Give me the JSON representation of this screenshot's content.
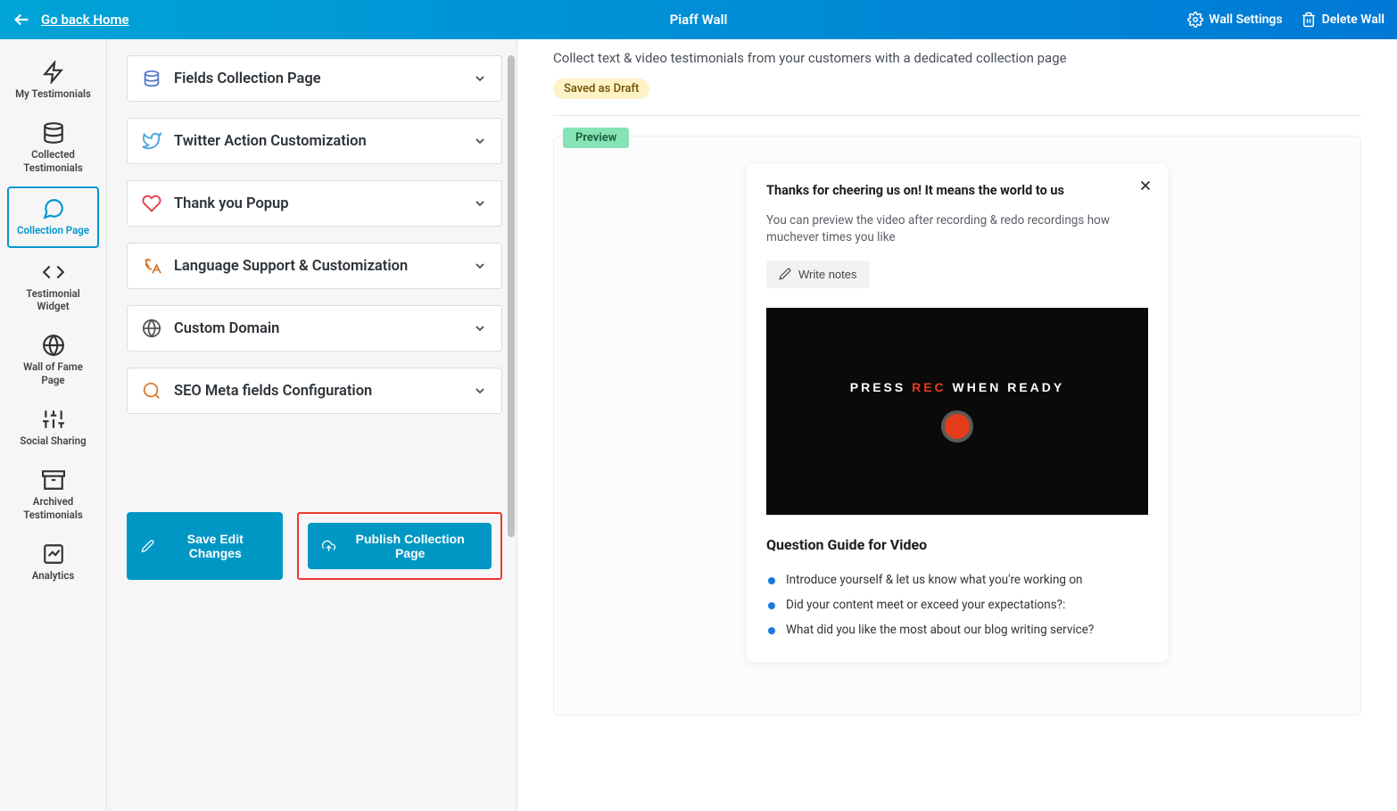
{
  "topbar": {
    "back_label": "Go back Home",
    "title": "Piaff Wall",
    "settings_label": "Wall Settings",
    "delete_label": "Delete Wall"
  },
  "sidebar": {
    "items": [
      {
        "label": "My Testimonials"
      },
      {
        "label": "Collected Testimonials"
      },
      {
        "label": "Collection Page"
      },
      {
        "label": "Testimonial Widget"
      },
      {
        "label": "Wall of Fame Page"
      },
      {
        "label": "Social Sharing"
      },
      {
        "label": "Archived Testimonials"
      },
      {
        "label": "Analytics"
      }
    ]
  },
  "panel": {
    "accordions": [
      {
        "label": "Fields Collection Page"
      },
      {
        "label": "Twitter Action Customization"
      },
      {
        "label": "Thank you Popup"
      },
      {
        "label": "Language Support & Customization"
      },
      {
        "label": "Custom Domain"
      },
      {
        "label": "SEO Meta fields Configuration"
      }
    ],
    "save_label": "Save Edit Changes",
    "publish_label": "Publish Collection Page"
  },
  "preview": {
    "intro": "Collect text & video testimonials from your customers with a dedicated collection page",
    "draft_badge": "Saved as Draft",
    "preview_badge": "Preview",
    "card": {
      "title": "Thanks for cheering us on! It means the world to us",
      "subtitle": "You can preview the video after recording & redo recordings how muchever times you like",
      "write_notes": "Write notes",
      "press_pre": "PRESS ",
      "press_rec": "REC",
      "press_post": " WHEN READY",
      "question_title": "Question Guide for Video",
      "questions": [
        "Introduce yourself & let us know what you're working on",
        "Did your content meet or exceed your expectations?:",
        "What did you like the most about our blog writing service?"
      ]
    }
  }
}
